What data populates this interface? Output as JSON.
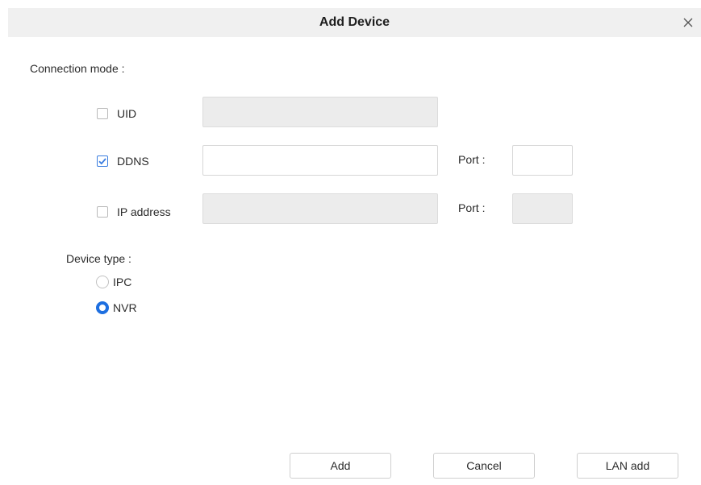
{
  "dialog": {
    "title": "Add Device",
    "close_icon": "close-icon"
  },
  "connection": {
    "label": "Connection mode :",
    "uid": {
      "label": "UID",
      "checked": false,
      "value": "",
      "enabled": false
    },
    "ddns": {
      "label": "DDNS",
      "checked": true,
      "value": "",
      "enabled": true,
      "port_label": "Port :",
      "port_value": ""
    },
    "ip": {
      "label": "IP address",
      "checked": false,
      "value": "",
      "enabled": false,
      "port_label": "Port :",
      "port_value": ""
    }
  },
  "device_type": {
    "label": "Device type :",
    "options": [
      {
        "label": "IPC",
        "selected": false
      },
      {
        "label": "NVR",
        "selected": true
      }
    ]
  },
  "buttons": {
    "add": "Add",
    "cancel": "Cancel",
    "lan_add": "LAN add"
  },
  "colors": {
    "accent": "#1e6fe0",
    "titlebar": "#f0f0f0",
    "disabled_field": "#ececec"
  }
}
